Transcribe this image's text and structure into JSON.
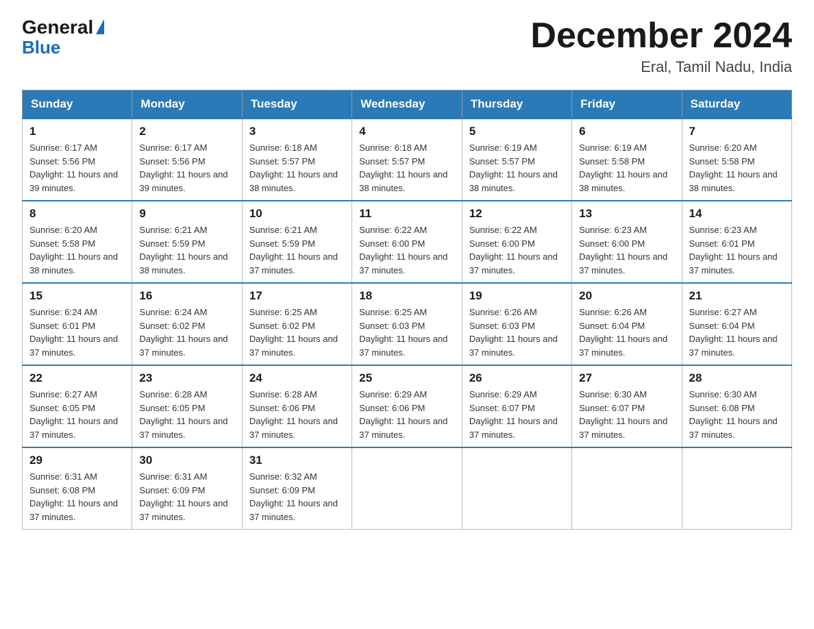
{
  "logo": {
    "general": "General",
    "blue": "Blue"
  },
  "header": {
    "title": "December 2024",
    "subtitle": "Eral, Tamil Nadu, India"
  },
  "weekdays": [
    "Sunday",
    "Monday",
    "Tuesday",
    "Wednesday",
    "Thursday",
    "Friday",
    "Saturday"
  ],
  "weeks": [
    [
      {
        "day": "1",
        "sunrise": "6:17 AM",
        "sunset": "5:56 PM",
        "daylight": "11 hours and 39 minutes."
      },
      {
        "day": "2",
        "sunrise": "6:17 AM",
        "sunset": "5:56 PM",
        "daylight": "11 hours and 39 minutes."
      },
      {
        "day": "3",
        "sunrise": "6:18 AM",
        "sunset": "5:57 PM",
        "daylight": "11 hours and 38 minutes."
      },
      {
        "day": "4",
        "sunrise": "6:18 AM",
        "sunset": "5:57 PM",
        "daylight": "11 hours and 38 minutes."
      },
      {
        "day": "5",
        "sunrise": "6:19 AM",
        "sunset": "5:57 PM",
        "daylight": "11 hours and 38 minutes."
      },
      {
        "day": "6",
        "sunrise": "6:19 AM",
        "sunset": "5:58 PM",
        "daylight": "11 hours and 38 minutes."
      },
      {
        "day": "7",
        "sunrise": "6:20 AM",
        "sunset": "5:58 PM",
        "daylight": "11 hours and 38 minutes."
      }
    ],
    [
      {
        "day": "8",
        "sunrise": "6:20 AM",
        "sunset": "5:58 PM",
        "daylight": "11 hours and 38 minutes."
      },
      {
        "day": "9",
        "sunrise": "6:21 AM",
        "sunset": "5:59 PM",
        "daylight": "11 hours and 38 minutes."
      },
      {
        "day": "10",
        "sunrise": "6:21 AM",
        "sunset": "5:59 PM",
        "daylight": "11 hours and 37 minutes."
      },
      {
        "day": "11",
        "sunrise": "6:22 AM",
        "sunset": "6:00 PM",
        "daylight": "11 hours and 37 minutes."
      },
      {
        "day": "12",
        "sunrise": "6:22 AM",
        "sunset": "6:00 PM",
        "daylight": "11 hours and 37 minutes."
      },
      {
        "day": "13",
        "sunrise": "6:23 AM",
        "sunset": "6:00 PM",
        "daylight": "11 hours and 37 minutes."
      },
      {
        "day": "14",
        "sunrise": "6:23 AM",
        "sunset": "6:01 PM",
        "daylight": "11 hours and 37 minutes."
      }
    ],
    [
      {
        "day": "15",
        "sunrise": "6:24 AM",
        "sunset": "6:01 PM",
        "daylight": "11 hours and 37 minutes."
      },
      {
        "day": "16",
        "sunrise": "6:24 AM",
        "sunset": "6:02 PM",
        "daylight": "11 hours and 37 minutes."
      },
      {
        "day": "17",
        "sunrise": "6:25 AM",
        "sunset": "6:02 PM",
        "daylight": "11 hours and 37 minutes."
      },
      {
        "day": "18",
        "sunrise": "6:25 AM",
        "sunset": "6:03 PM",
        "daylight": "11 hours and 37 minutes."
      },
      {
        "day": "19",
        "sunrise": "6:26 AM",
        "sunset": "6:03 PM",
        "daylight": "11 hours and 37 minutes."
      },
      {
        "day": "20",
        "sunrise": "6:26 AM",
        "sunset": "6:04 PM",
        "daylight": "11 hours and 37 minutes."
      },
      {
        "day": "21",
        "sunrise": "6:27 AM",
        "sunset": "6:04 PM",
        "daylight": "11 hours and 37 minutes."
      }
    ],
    [
      {
        "day": "22",
        "sunrise": "6:27 AM",
        "sunset": "6:05 PM",
        "daylight": "11 hours and 37 minutes."
      },
      {
        "day": "23",
        "sunrise": "6:28 AM",
        "sunset": "6:05 PM",
        "daylight": "11 hours and 37 minutes."
      },
      {
        "day": "24",
        "sunrise": "6:28 AM",
        "sunset": "6:06 PM",
        "daylight": "11 hours and 37 minutes."
      },
      {
        "day": "25",
        "sunrise": "6:29 AM",
        "sunset": "6:06 PM",
        "daylight": "11 hours and 37 minutes."
      },
      {
        "day": "26",
        "sunrise": "6:29 AM",
        "sunset": "6:07 PM",
        "daylight": "11 hours and 37 minutes."
      },
      {
        "day": "27",
        "sunrise": "6:30 AM",
        "sunset": "6:07 PM",
        "daylight": "11 hours and 37 minutes."
      },
      {
        "day": "28",
        "sunrise": "6:30 AM",
        "sunset": "6:08 PM",
        "daylight": "11 hours and 37 minutes."
      }
    ],
    [
      {
        "day": "29",
        "sunrise": "6:31 AM",
        "sunset": "6:08 PM",
        "daylight": "11 hours and 37 minutes."
      },
      {
        "day": "30",
        "sunrise": "6:31 AM",
        "sunset": "6:09 PM",
        "daylight": "11 hours and 37 minutes."
      },
      {
        "day": "31",
        "sunrise": "6:32 AM",
        "sunset": "6:09 PM",
        "daylight": "11 hours and 37 minutes."
      },
      null,
      null,
      null,
      null
    ]
  ],
  "labels": {
    "sunrise": "Sunrise: ",
    "sunset": "Sunset: ",
    "daylight": "Daylight: "
  }
}
